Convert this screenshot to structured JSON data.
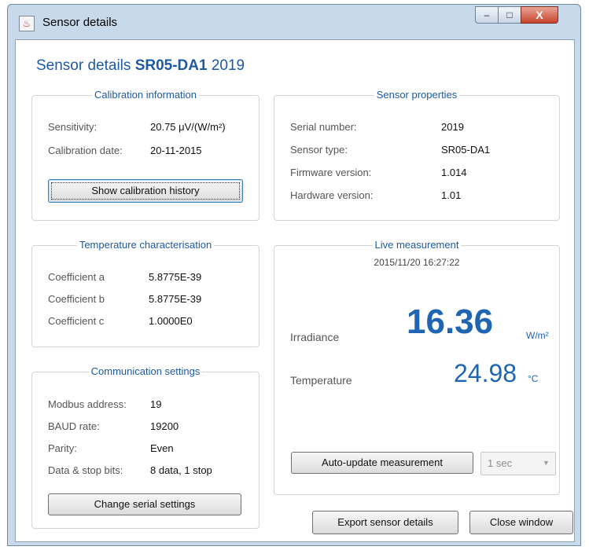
{
  "window": {
    "title": "Sensor details",
    "controls": {
      "minimize": "–",
      "maximize": "□",
      "close": "X"
    }
  },
  "heading": {
    "prefix": "Sensor details",
    "model": "SR05-DA1",
    "serial": "2019"
  },
  "calibration": {
    "title": "Calibration information",
    "sensitivity_label": "Sensitivity:",
    "sensitivity_value": "20.75 μV/(W/m²)",
    "date_label": "Calibration date:",
    "date_value": "20-11-2015",
    "history_button": "Show calibration history"
  },
  "properties": {
    "title": "Sensor properties",
    "rows": [
      {
        "label": "Serial number:",
        "value": "2019"
      },
      {
        "label": "Sensor type:",
        "value": "SR05-DA1"
      },
      {
        "label": "Firmware version:",
        "value": "1.014"
      },
      {
        "label": "Hardware version:",
        "value": "1.01"
      }
    ]
  },
  "temperature": {
    "title": "Temperature characterisation",
    "rows": [
      {
        "label": "Coefficient a",
        "value": "5.8775E-39"
      },
      {
        "label": "Coefficient b",
        "value": "5.8775E-39"
      },
      {
        "label": "Coefficient c",
        "value": "1.0000E0"
      }
    ]
  },
  "communication": {
    "title": "Communication settings",
    "rows": [
      {
        "label": "Modbus address:",
        "value": "19"
      },
      {
        "label": "BAUD rate:",
        "value": "19200"
      },
      {
        "label": "Parity:",
        "value": "Even"
      },
      {
        "label": "Data & stop bits:",
        "value": "8 data, 1 stop"
      }
    ],
    "change_button": "Change serial settings"
  },
  "live": {
    "title": "Live measurement",
    "timestamp": "2015/11/20 16:27:22",
    "irradiance_label": "Irradiance",
    "irradiance_value": "16.36",
    "irradiance_unit": "W/m²",
    "temperature_label": "Temperature",
    "temperature_value": "24.98",
    "temperature_unit": "°C",
    "auto_update_button": "Auto-update measurement",
    "interval_selected": "1 sec"
  },
  "footer": {
    "export_button": "Export sensor details",
    "close_button": "Close window"
  },
  "colors": {
    "accent": "#1e5aa3",
    "value_blue": "#1f65b2"
  }
}
